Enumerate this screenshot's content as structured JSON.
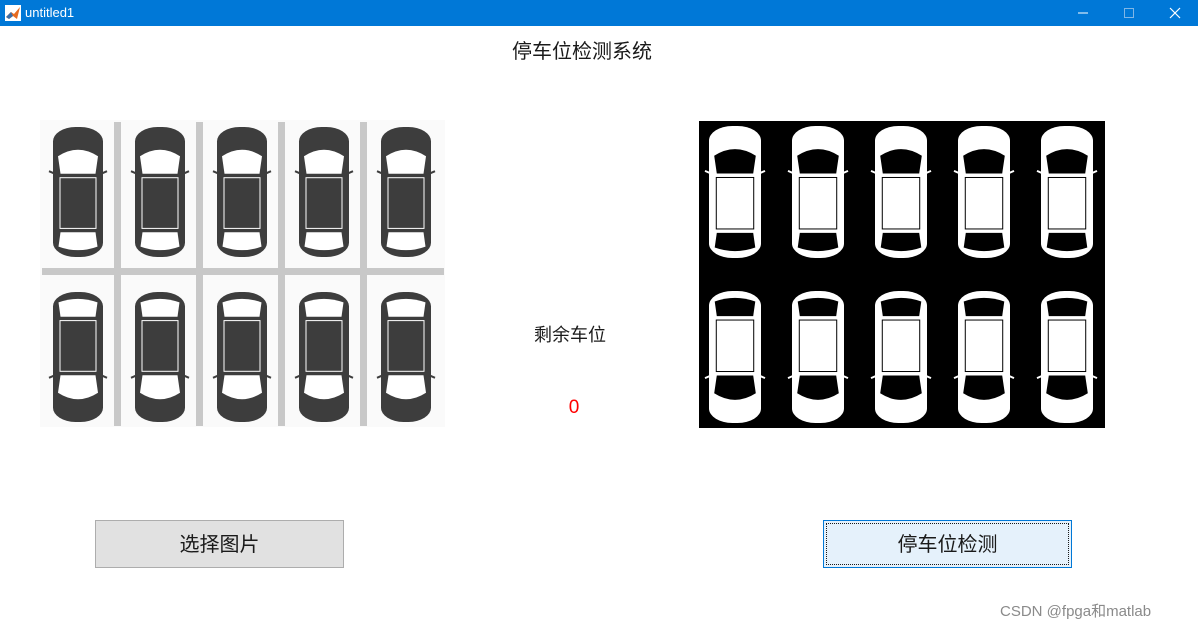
{
  "window": {
    "title": "untitled1"
  },
  "app": {
    "title": "停车位检测系统"
  },
  "panels": {
    "original_image": {
      "rows": 2,
      "cols": 5,
      "cars_present": 10
    },
    "binary_image": {
      "rows": 2,
      "cols": 5,
      "cars_present": 10
    }
  },
  "status": {
    "remaining_label": "剩余车位",
    "remaining_value": "0"
  },
  "buttons": {
    "select_image": "选择图片",
    "detect": "停车位检测"
  },
  "watermark": "CSDN @fpga和matlab",
  "colors": {
    "titlebar": "#0078d7",
    "remaining_value": "#ff0000",
    "detect_button_bg": "#e5f1fb",
    "select_button_bg": "#e1e1e1"
  }
}
